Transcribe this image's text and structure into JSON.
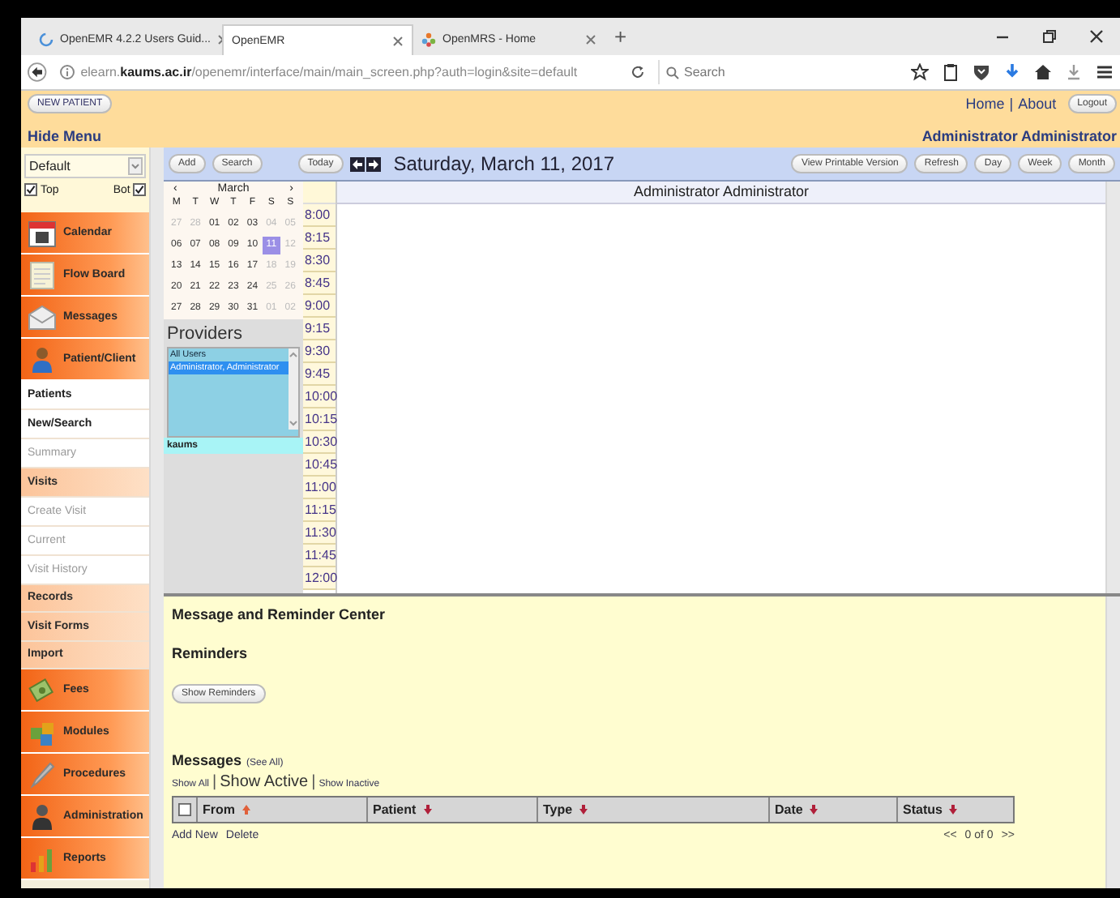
{
  "browser": {
    "tabs": [
      {
        "label": "OpenEMR 4.2.2 Users Guid...",
        "selected": false
      },
      {
        "label": "OpenEMR",
        "selected": true
      },
      {
        "label": "OpenMRS - Home",
        "selected": false
      }
    ],
    "new_tab": "+",
    "url": "elearn.**kaums.ac.ir**/openemr/interface/main/main_screen.php?auth=login&site=default",
    "search_placeholder": "Search"
  },
  "header": {
    "new_patient": "NEW PATIENT",
    "hide_menu": "Hide Menu",
    "links": [
      "Home",
      "About"
    ],
    "separator": "|",
    "logout": "Logout",
    "user": "Administrator Administrator"
  },
  "sidebar": {
    "facility": "Default",
    "checks": [
      {
        "label": "Top",
        "checked": true
      },
      {
        "label": "Bot",
        "checked": true
      }
    ],
    "items": [
      {
        "label": "Calendar",
        "kind": "main"
      },
      {
        "label": "Flow Board",
        "kind": "main"
      },
      {
        "label": "Messages",
        "kind": "main"
      },
      {
        "label": "Patient/Client",
        "kind": "main"
      },
      {
        "label": "Patients",
        "kind": "link"
      },
      {
        "label": "New/Search",
        "kind": "link"
      },
      {
        "label": "Summary",
        "kind": "disabled"
      },
      {
        "label": "Visits",
        "kind": "section"
      },
      {
        "label": "Create Visit",
        "kind": "disabled"
      },
      {
        "label": "Current",
        "kind": "disabled"
      },
      {
        "label": "Visit History",
        "kind": "disabled"
      },
      {
        "label": "Records",
        "kind": "section"
      },
      {
        "label": "Visit Forms",
        "kind": "section"
      },
      {
        "label": "Import",
        "kind": "section"
      },
      {
        "label": "Fees",
        "kind": "main"
      },
      {
        "label": "Modules",
        "kind": "main"
      },
      {
        "label": "Procedures",
        "kind": "main"
      },
      {
        "label": "Administration",
        "kind": "main"
      },
      {
        "label": "Reports",
        "kind": "main"
      }
    ]
  },
  "toolbar": {
    "left_buttons": [
      "Add",
      "Search"
    ],
    "today": "Today",
    "date_title": "Saturday, March 11, 2017",
    "right_buttons": [
      "View Printable Version",
      "Refresh",
      "Day",
      "Week",
      "Month"
    ]
  },
  "mini_calendar": {
    "prev": "‹",
    "month": "March",
    "next": "›",
    "weekdays": [
      "M",
      "T",
      "W",
      "T",
      "F",
      "S",
      "S"
    ],
    "weeks": [
      [
        {
          "day": "27",
          "muted": true,
          "selected": false
        },
        {
          "day": "28",
          "muted": true,
          "selected": false
        },
        {
          "day": "01",
          "muted": false,
          "selected": false
        },
        {
          "day": "02",
          "muted": false,
          "selected": false
        },
        {
          "day": "03",
          "muted": false,
          "selected": false
        },
        {
          "day": "04",
          "muted": true,
          "selected": false
        },
        {
          "day": "05",
          "muted": true,
          "selected": false
        }
      ],
      [
        {
          "day": "06",
          "muted": false,
          "selected": false
        },
        {
          "day": "07",
          "muted": false,
          "selected": false
        },
        {
          "day": "08",
          "muted": false,
          "selected": false
        },
        {
          "day": "09",
          "muted": false,
          "selected": false
        },
        {
          "day": "10",
          "muted": false,
          "selected": false
        },
        {
          "day": "11",
          "muted": false,
          "selected": true
        },
        {
          "day": "12",
          "muted": true,
          "selected": false
        }
      ],
      [
        {
          "day": "13",
          "muted": false,
          "selected": false
        },
        {
          "day": "14",
          "muted": false,
          "selected": false
        },
        {
          "day": "15",
          "muted": false,
          "selected": false
        },
        {
          "day": "16",
          "muted": false,
          "selected": false
        },
        {
          "day": "17",
          "muted": false,
          "selected": false
        },
        {
          "day": "18",
          "muted": true,
          "selected": false
        },
        {
          "day": "19",
          "muted": true,
          "selected": false
        }
      ],
      [
        {
          "day": "20",
          "muted": false,
          "selected": false
        },
        {
          "day": "21",
          "muted": false,
          "selected": false
        },
        {
          "day": "22",
          "muted": false,
          "selected": false
        },
        {
          "day": "23",
          "muted": false,
          "selected": false
        },
        {
          "day": "24",
          "muted": false,
          "selected": false
        },
        {
          "day": "25",
          "muted": true,
          "selected": false
        },
        {
          "day": "26",
          "muted": true,
          "selected": false
        }
      ],
      [
        {
          "day": "27",
          "muted": false,
          "selected": false
        },
        {
          "day": "28",
          "muted": false,
          "selected": false
        },
        {
          "day": "29",
          "muted": false,
          "selected": false
        },
        {
          "day": "30",
          "muted": false,
          "selected": false
        },
        {
          "day": "31",
          "muted": false,
          "selected": false
        },
        {
          "day": "01",
          "muted": true,
          "selected": false
        },
        {
          "day": "02",
          "muted": true,
          "selected": false
        }
      ]
    ]
  },
  "providers": {
    "title": "Providers",
    "options": [
      {
        "label": "All Users",
        "selected": false
      },
      {
        "label": "Administrator, Administrator",
        "selected": true
      }
    ],
    "facility": "kaums"
  },
  "schedule": {
    "column_header": "Administrator Administrator",
    "times": [
      "8:00",
      "8:15",
      "8:30",
      "8:45",
      "9:00",
      "9:15",
      "9:30",
      "9:45",
      "10:00",
      "10:15",
      "10:30",
      "10:45",
      "11:00",
      "11:15",
      "11:30",
      "11:45",
      "12:00"
    ]
  },
  "messages": {
    "title": "Message and Reminder Center",
    "reminders_title": "Reminders",
    "show_reminders": "Show Reminders",
    "messages_title": "Messages",
    "see_all": "(See All)",
    "filters": [
      {
        "label": "Show All",
        "selected": false
      },
      {
        "label": "Show Active",
        "selected": true
      },
      {
        "label": "Show Inactive",
        "selected": false
      }
    ],
    "separators": [
      "|",
      "|"
    ],
    "select_all_checked": false,
    "columns": [
      {
        "label": "From",
        "sorted": true
      },
      {
        "label": "Patient",
        "sorted": false
      },
      {
        "label": "Type",
        "sorted": false
      },
      {
        "label": "Date",
        "sorted": false
      },
      {
        "label": "Status",
        "sorted": false
      }
    ],
    "actions": [
      "Add New",
      "Delete"
    ],
    "pager": {
      "prev": "<<",
      "text": "0 of 0",
      "next": ">>"
    }
  }
}
